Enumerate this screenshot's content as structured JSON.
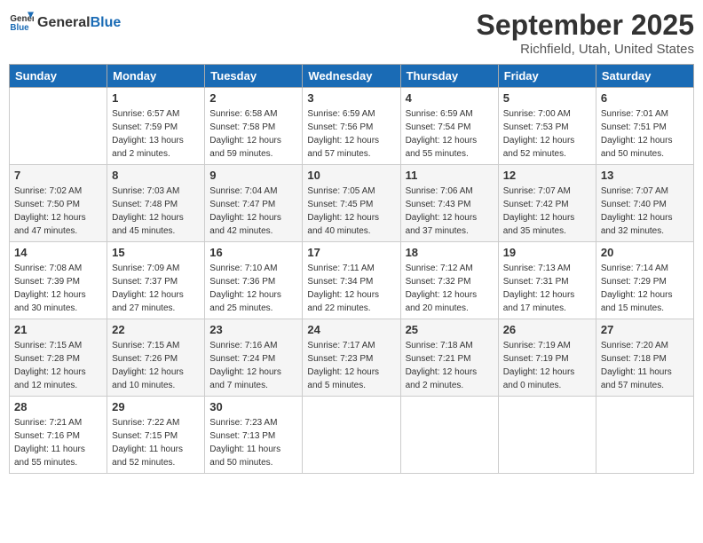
{
  "header": {
    "logo_general": "General",
    "logo_blue": "Blue",
    "month_title": "September 2025",
    "location": "Richfield, Utah, United States"
  },
  "days_of_week": [
    "Sunday",
    "Monday",
    "Tuesday",
    "Wednesday",
    "Thursday",
    "Friday",
    "Saturday"
  ],
  "weeks": [
    [
      {
        "day": "",
        "sunrise": "",
        "sunset": "",
        "daylight": ""
      },
      {
        "day": "1",
        "sunrise": "Sunrise: 6:57 AM",
        "sunset": "Sunset: 7:59 PM",
        "daylight": "Daylight: 13 hours and 2 minutes."
      },
      {
        "day": "2",
        "sunrise": "Sunrise: 6:58 AM",
        "sunset": "Sunset: 7:58 PM",
        "daylight": "Daylight: 12 hours and 59 minutes."
      },
      {
        "day": "3",
        "sunrise": "Sunrise: 6:59 AM",
        "sunset": "Sunset: 7:56 PM",
        "daylight": "Daylight: 12 hours and 57 minutes."
      },
      {
        "day": "4",
        "sunrise": "Sunrise: 6:59 AM",
        "sunset": "Sunset: 7:54 PM",
        "daylight": "Daylight: 12 hours and 55 minutes."
      },
      {
        "day": "5",
        "sunrise": "Sunrise: 7:00 AM",
        "sunset": "Sunset: 7:53 PM",
        "daylight": "Daylight: 12 hours and 52 minutes."
      },
      {
        "day": "6",
        "sunrise": "Sunrise: 7:01 AM",
        "sunset": "Sunset: 7:51 PM",
        "daylight": "Daylight: 12 hours and 50 minutes."
      }
    ],
    [
      {
        "day": "7",
        "sunrise": "Sunrise: 7:02 AM",
        "sunset": "Sunset: 7:50 PM",
        "daylight": "Daylight: 12 hours and 47 minutes."
      },
      {
        "day": "8",
        "sunrise": "Sunrise: 7:03 AM",
        "sunset": "Sunset: 7:48 PM",
        "daylight": "Daylight: 12 hours and 45 minutes."
      },
      {
        "day": "9",
        "sunrise": "Sunrise: 7:04 AM",
        "sunset": "Sunset: 7:47 PM",
        "daylight": "Daylight: 12 hours and 42 minutes."
      },
      {
        "day": "10",
        "sunrise": "Sunrise: 7:05 AM",
        "sunset": "Sunset: 7:45 PM",
        "daylight": "Daylight: 12 hours and 40 minutes."
      },
      {
        "day": "11",
        "sunrise": "Sunrise: 7:06 AM",
        "sunset": "Sunset: 7:43 PM",
        "daylight": "Daylight: 12 hours and 37 minutes."
      },
      {
        "day": "12",
        "sunrise": "Sunrise: 7:07 AM",
        "sunset": "Sunset: 7:42 PM",
        "daylight": "Daylight: 12 hours and 35 minutes."
      },
      {
        "day": "13",
        "sunrise": "Sunrise: 7:07 AM",
        "sunset": "Sunset: 7:40 PM",
        "daylight": "Daylight: 12 hours and 32 minutes."
      }
    ],
    [
      {
        "day": "14",
        "sunrise": "Sunrise: 7:08 AM",
        "sunset": "Sunset: 7:39 PM",
        "daylight": "Daylight: 12 hours and 30 minutes."
      },
      {
        "day": "15",
        "sunrise": "Sunrise: 7:09 AM",
        "sunset": "Sunset: 7:37 PM",
        "daylight": "Daylight: 12 hours and 27 minutes."
      },
      {
        "day": "16",
        "sunrise": "Sunrise: 7:10 AM",
        "sunset": "Sunset: 7:36 PM",
        "daylight": "Daylight: 12 hours and 25 minutes."
      },
      {
        "day": "17",
        "sunrise": "Sunrise: 7:11 AM",
        "sunset": "Sunset: 7:34 PM",
        "daylight": "Daylight: 12 hours and 22 minutes."
      },
      {
        "day": "18",
        "sunrise": "Sunrise: 7:12 AM",
        "sunset": "Sunset: 7:32 PM",
        "daylight": "Daylight: 12 hours and 20 minutes."
      },
      {
        "day": "19",
        "sunrise": "Sunrise: 7:13 AM",
        "sunset": "Sunset: 7:31 PM",
        "daylight": "Daylight: 12 hours and 17 minutes."
      },
      {
        "day": "20",
        "sunrise": "Sunrise: 7:14 AM",
        "sunset": "Sunset: 7:29 PM",
        "daylight": "Daylight: 12 hours and 15 minutes."
      }
    ],
    [
      {
        "day": "21",
        "sunrise": "Sunrise: 7:15 AM",
        "sunset": "Sunset: 7:28 PM",
        "daylight": "Daylight: 12 hours and 12 minutes."
      },
      {
        "day": "22",
        "sunrise": "Sunrise: 7:15 AM",
        "sunset": "Sunset: 7:26 PM",
        "daylight": "Daylight: 12 hours and 10 minutes."
      },
      {
        "day": "23",
        "sunrise": "Sunrise: 7:16 AM",
        "sunset": "Sunset: 7:24 PM",
        "daylight": "Daylight: 12 hours and 7 minutes."
      },
      {
        "day": "24",
        "sunrise": "Sunrise: 7:17 AM",
        "sunset": "Sunset: 7:23 PM",
        "daylight": "Daylight: 12 hours and 5 minutes."
      },
      {
        "day": "25",
        "sunrise": "Sunrise: 7:18 AM",
        "sunset": "Sunset: 7:21 PM",
        "daylight": "Daylight: 12 hours and 2 minutes."
      },
      {
        "day": "26",
        "sunrise": "Sunrise: 7:19 AM",
        "sunset": "Sunset: 7:19 PM",
        "daylight": "Daylight: 12 hours and 0 minutes."
      },
      {
        "day": "27",
        "sunrise": "Sunrise: 7:20 AM",
        "sunset": "Sunset: 7:18 PM",
        "daylight": "Daylight: 11 hours and 57 minutes."
      }
    ],
    [
      {
        "day": "28",
        "sunrise": "Sunrise: 7:21 AM",
        "sunset": "Sunset: 7:16 PM",
        "daylight": "Daylight: 11 hours and 55 minutes."
      },
      {
        "day": "29",
        "sunrise": "Sunrise: 7:22 AM",
        "sunset": "Sunset: 7:15 PM",
        "daylight": "Daylight: 11 hours and 52 minutes."
      },
      {
        "day": "30",
        "sunrise": "Sunrise: 7:23 AM",
        "sunset": "Sunset: 7:13 PM",
        "daylight": "Daylight: 11 hours and 50 minutes."
      },
      {
        "day": "",
        "sunrise": "",
        "sunset": "",
        "daylight": ""
      },
      {
        "day": "",
        "sunrise": "",
        "sunset": "",
        "daylight": ""
      },
      {
        "day": "",
        "sunrise": "",
        "sunset": "",
        "daylight": ""
      },
      {
        "day": "",
        "sunrise": "",
        "sunset": "",
        "daylight": ""
      }
    ]
  ]
}
